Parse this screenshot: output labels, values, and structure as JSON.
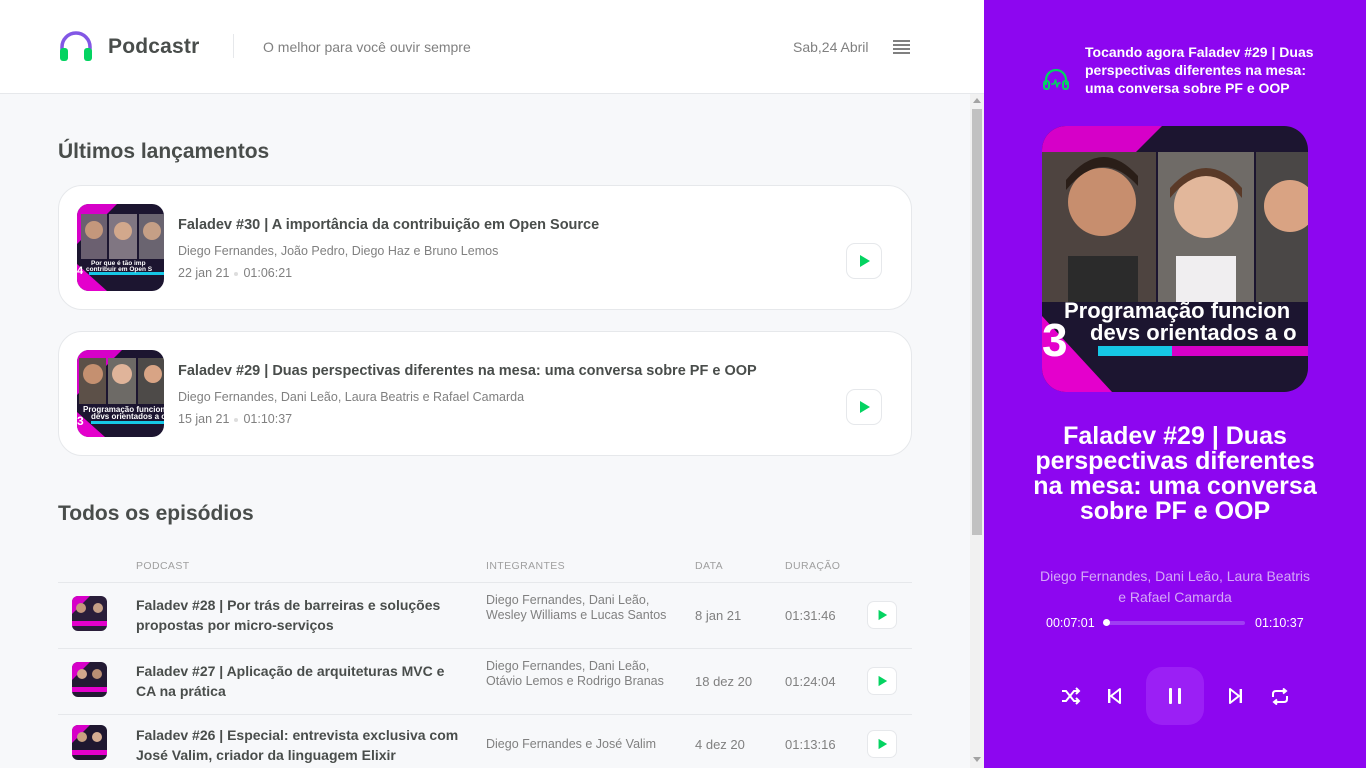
{
  "header": {
    "app_name": "Podcastr",
    "tagline": "O melhor para você ouvir sempre",
    "date": "Sab,24 Abril"
  },
  "latest": {
    "title": "Últimos lançamentos",
    "episodes": [
      {
        "title": "Faladev #30 | A importância da contribuição em Open Source",
        "members": "Diego Fernandes, João Pedro, Diego Haz e Bruno Lemos",
        "date": "22 jan 21",
        "duration": "01:06:21",
        "thumb_caption_1": "Por que é tão imp",
        "thumb_caption_2": "contribuir em Open S"
      },
      {
        "title": "Faladev #29 | Duas perspectivas diferentes na mesa: uma conversa sobre PF e OOP",
        "members": "Diego Fernandes, Dani Leão, Laura Beatris e Rafael Camarda",
        "date": "15 jan 21",
        "duration": "01:10:37",
        "thumb_caption_1": "Programação funcion",
        "thumb_caption_2": "devs orientados a o"
      }
    ]
  },
  "all": {
    "title": "Todos os episódios",
    "columns": [
      "Podcast",
      "Integrantes",
      "Data",
      "Duração"
    ],
    "rows": [
      {
        "title": "Faladev #28 | Por trás de barreiras e soluções propostas por micro-serviços",
        "members": "Diego Fernandes, Dani Leão, Wesley Williams e Lucas Santos",
        "date": "8 jan 21",
        "duration": "01:31:46"
      },
      {
        "title": "Faladev #27 | Aplicação de arquiteturas MVC e CA na prática",
        "members": "Diego Fernandes, Dani Leão, Otávio Lemos e Rodrigo Branas",
        "date": "18 dez 20",
        "duration": "01:24:04"
      },
      {
        "title": "Faladev #26 | Especial: entrevista exclusiva com José Valim, criador da linguagem Elixir",
        "members": "Diego Fernandes e José Valim",
        "date": "4 dez 20",
        "duration": "01:13:16"
      }
    ]
  },
  "player": {
    "now_playing": "Tocando agora Faladev #29 | Duas perspectivas diferentes na mesa: uma conversa sobre PF e OOP",
    "title": "Faladev #29 | Duas perspectivas diferentes na mesa: uma conversa sobre PF e OOP",
    "members": "Diego Fernandes, Dani Leão, Laura Beatris e Rafael Camarda",
    "current_time": "00:07:01",
    "total_time": "01:10:37",
    "progress": 0.0,
    "cover_caption_1": "Programação funcion",
    "cover_caption_2": "devs orientados a o",
    "cover_number": "3"
  },
  "colors": {
    "accent_green": "#04d361",
    "player_bg": "#8d06f0",
    "text": "#494d4b",
    "muted": "#808080"
  },
  "icons": [
    "headphones-logo-icon",
    "menu-icon",
    "play-icon",
    "playing-headphones-icon",
    "shuffle-icon",
    "previous-icon",
    "pause-icon",
    "next-icon",
    "repeat-icon"
  ]
}
